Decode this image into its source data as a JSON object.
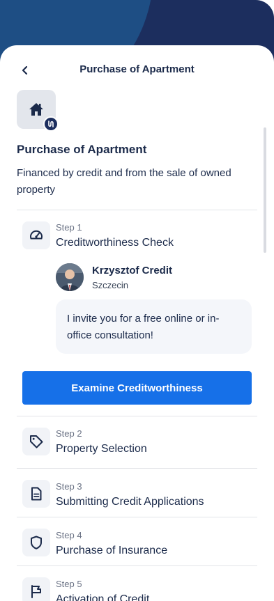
{
  "header": {
    "title": "Purchase of Apartment",
    "back_icon": "chevron-left-icon"
  },
  "property": {
    "icon": "home-icon",
    "badge_icon": "loan-badge-icon",
    "title": "Purchase of Apartment",
    "description": "Financed by credit and from the sale of owned property"
  },
  "steps": [
    {
      "number": "Step 1",
      "name": "Creditworthiness Check",
      "icon": "speedometer-icon",
      "advisor": {
        "name": "Krzysztof Credit",
        "city": "Szczecin",
        "message": "I invite you for a free online or in-office consultation!"
      },
      "cta": "Examine Creditworthiness"
    },
    {
      "number": "Step 2",
      "name": "Property Selection",
      "icon": "tag-icon"
    },
    {
      "number": "Step 3",
      "name": "Submitting Credit Applications",
      "icon": "document-icon"
    },
    {
      "number": "Step 4",
      "name": "Purchase of Insurance",
      "icon": "shield-icon"
    },
    {
      "number": "Step 5",
      "name": "Activation of Credit",
      "icon": "flag-icon"
    }
  ],
  "colors": {
    "navy": "#1c2e5e",
    "accent_blue": "#1670e8",
    "icon_bg": "#f1f3f7"
  }
}
